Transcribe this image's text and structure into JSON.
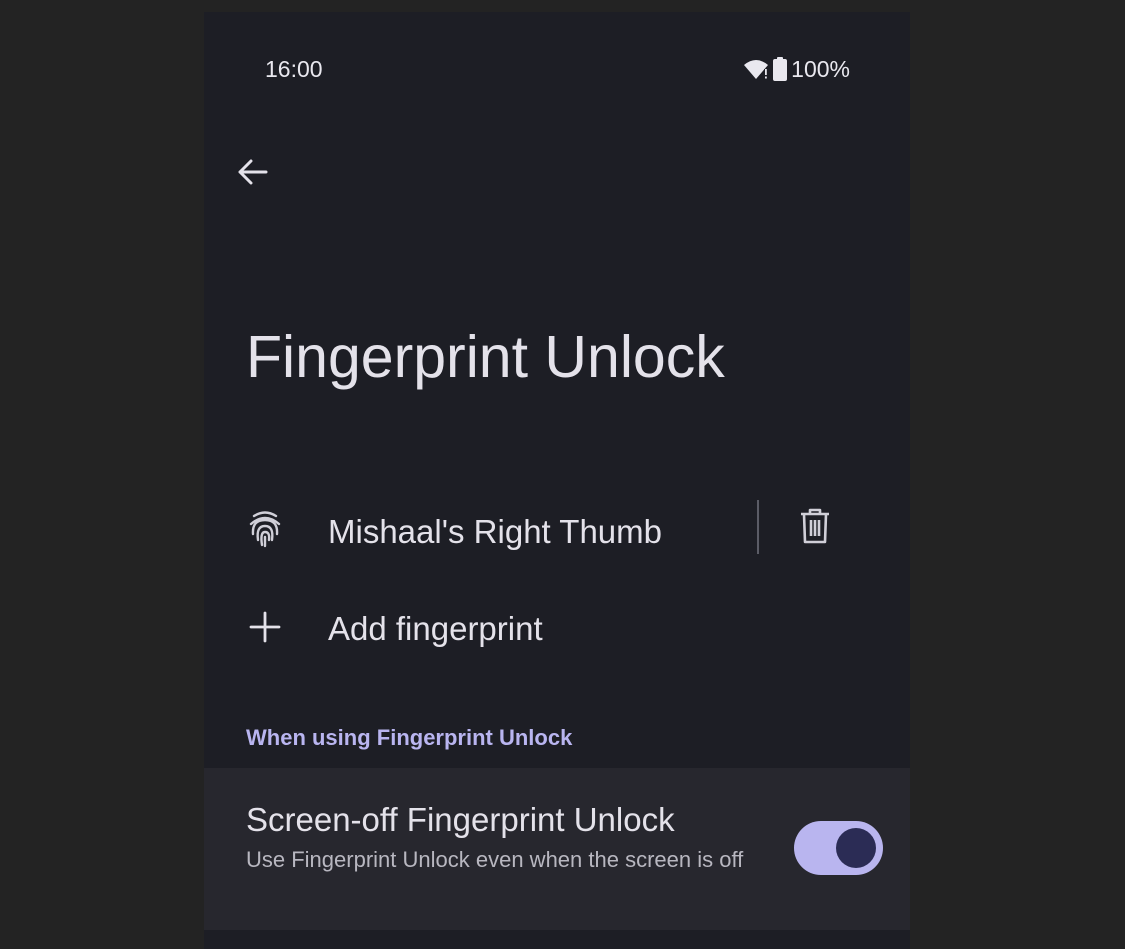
{
  "status_bar": {
    "time": "16:00",
    "battery_percent": "100%",
    "icons": [
      "wifi-icon",
      "battery-icon"
    ]
  },
  "header": {
    "back_icon": "arrow-left-icon",
    "title": "Fingerprint Unlock"
  },
  "fingerprints": [
    {
      "name": "Mishaal's Right Thumb",
      "icon": "fingerprint-icon",
      "action_icon": "trash-icon"
    }
  ],
  "add_fingerprint": {
    "label": "Add fingerprint",
    "icon": "plus-icon"
  },
  "section": {
    "header": "When using Fingerprint Unlock"
  },
  "screen_off_setting": {
    "title": "Screen-off Fingerprint Unlock",
    "description": "Use Fingerprint Unlock even when the screen is off",
    "enabled": true
  },
  "colors": {
    "background": "#1d1e25",
    "card": "#27272e",
    "accent": "#b9b5f0",
    "toggle_thumb": "#2b2c55",
    "text_primary": "#e4e2ea",
    "text_secondary": "#b8b7c0"
  }
}
